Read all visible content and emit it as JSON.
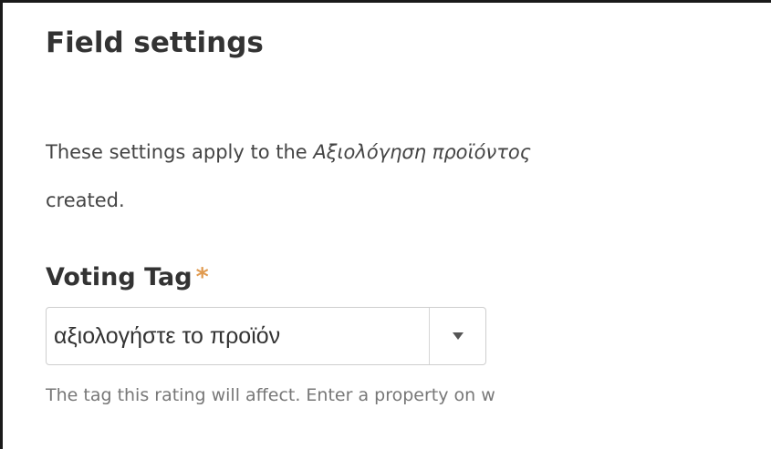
{
  "section": {
    "title": "Field settings"
  },
  "description": {
    "text_before": "These settings apply to the ",
    "entity_name": "Αξιολόγηση προϊόντος",
    "text_after": "created."
  },
  "field": {
    "label": "Voting Tag",
    "required_marker": "*",
    "selected_value": "αξιολογήστε το προϊόν",
    "help_text": "The tag this rating will affect. Enter a property on w"
  },
  "icons": {
    "dropdown": "chevron-down-icon"
  },
  "colors": {
    "required_star": "#e09a4f",
    "border": "#cfcfcf",
    "help_text": "#777777"
  }
}
